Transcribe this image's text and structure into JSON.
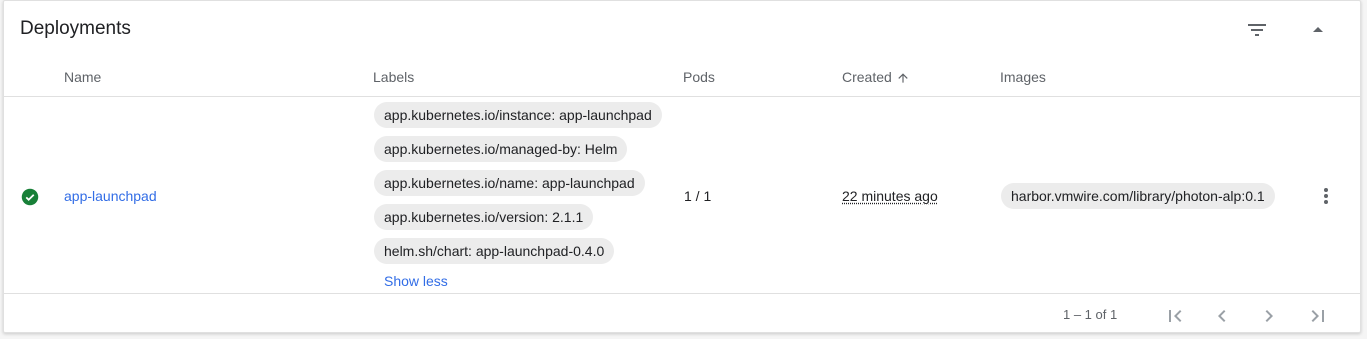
{
  "card": {
    "title": "Deployments"
  },
  "header_icons": {
    "filter": "filter-icon",
    "collapse": "collapse-icon"
  },
  "columns": [
    "Name",
    "Labels",
    "Pods",
    "Created",
    "Images"
  ],
  "created_sort": "arrow-up-icon",
  "rows": [
    {
      "status": "ok",
      "status_color": "#188038",
      "name": "app-launchpad",
      "labels": [
        "app.kubernetes.io/instance: app-launchpad",
        "app.kubernetes.io/managed-by: Helm",
        "app.kubernetes.io/name: app-launchpad",
        "app.kubernetes.io/version: 2.1.1",
        "helm.sh/chart: app-launchpad-0.4.0"
      ],
      "labels_toggle": "Show less",
      "pods": "1 / 1",
      "created": "22 minutes ago",
      "image": "harbor.vmwire.com/library/photon-alp:0.1"
    }
  ],
  "pagination": {
    "range": "1 – 1 of 1"
  },
  "colors": {
    "link": "#326de6",
    "chip_bg": "#ececec"
  }
}
